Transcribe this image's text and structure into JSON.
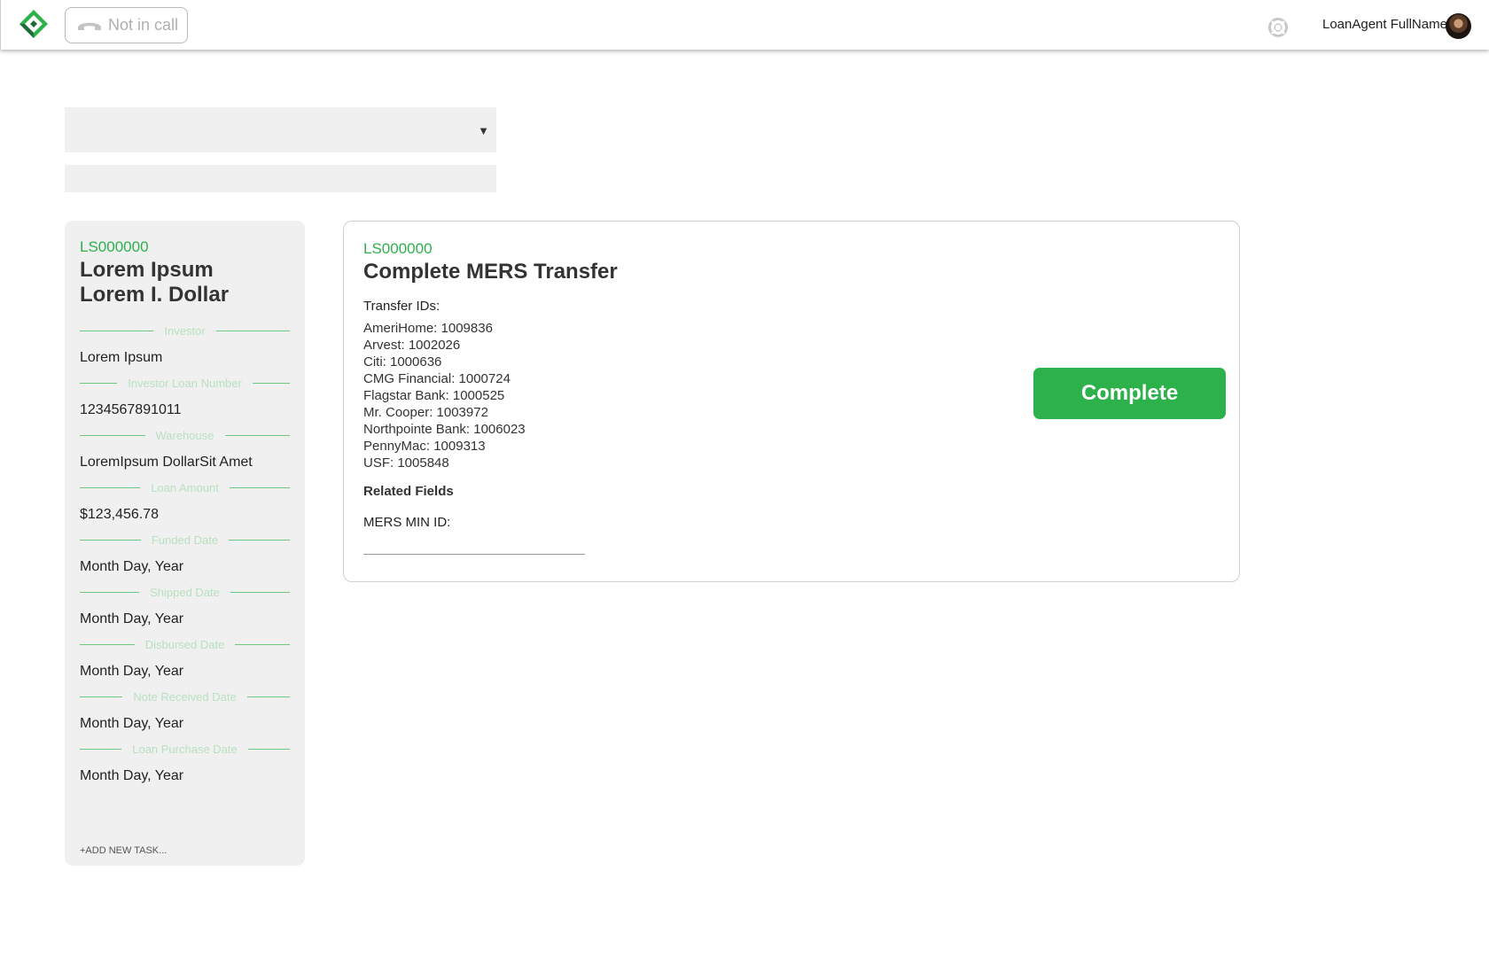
{
  "header": {
    "call_status": "Not in call",
    "user_name": "LoanAgent FullName",
    "brand_color": "#2db14b",
    "icons": [
      "logo-icon",
      "phone-icon",
      "help-icon",
      "avatar"
    ]
  },
  "filters": {
    "select_value": "",
    "search_value": ""
  },
  "summary": {
    "loan_id": "LS000000",
    "borrower_line1": "Lorem Ipsum",
    "borrower_line2": "Lorem I. Dollar",
    "fields": [
      {
        "label": "Investor",
        "value": "Lorem Ipsum"
      },
      {
        "label": "Investor Loan Number",
        "value": "1234567891011"
      },
      {
        "label": "Warehouse",
        "value": "LoremIpsum DollarSit Amet"
      },
      {
        "label": "Loan Amount",
        "value": "$123,456.78"
      },
      {
        "label": "Funded Date",
        "value": "Month Day, Year"
      },
      {
        "label": "Shipped Date",
        "value": "Month Day, Year"
      },
      {
        "label": "Disbursed Date",
        "value": "Month Day, Year"
      },
      {
        "label": "Note Received Date",
        "value": "Month Day, Year"
      },
      {
        "label": "Loan Purchase Date",
        "value": "Month Day, Year"
      }
    ],
    "add_task": "+ADD NEW TASK..."
  },
  "task": {
    "loan_id": "LS000000",
    "title": "Complete MERS Transfer",
    "transfer_ids_label": "Transfer IDs:",
    "transfer_ids": [
      "AmeriHome: 1009836",
      "Arvest: 1002026",
      "Citi: 1000636",
      "CMG Financial: 1000724",
      "Flagstar Bank: 1000525",
      "Mr. Cooper: 1003972",
      "Northpointe Bank: 1006023",
      "PennyMac: 1009313",
      "USF: 1005848"
    ],
    "related_fields_label": "Related Fields",
    "mers_min_label": "MERS MIN ID:",
    "mers_min_value": "",
    "complete_label": "Complete"
  }
}
